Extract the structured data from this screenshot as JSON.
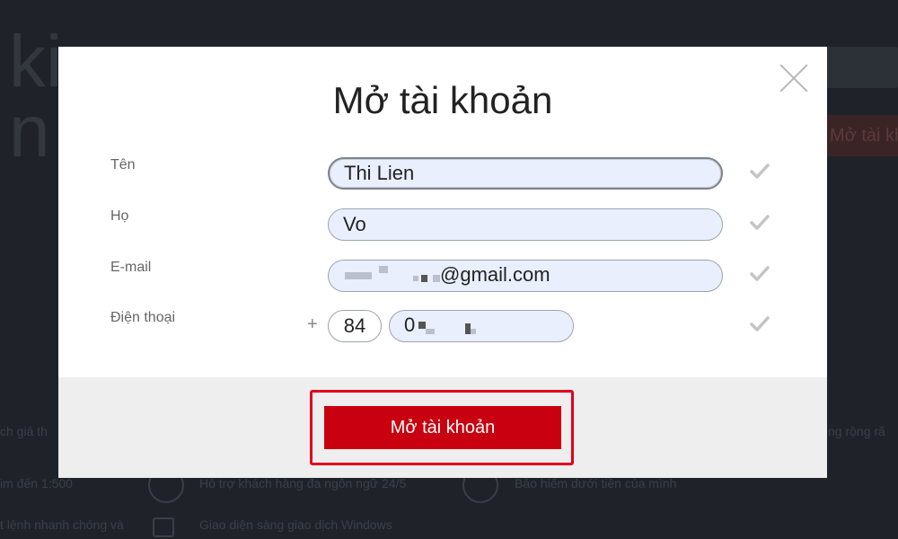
{
  "background": {
    "title_partial": "ki\nn b",
    "right_button_partial": "Mở tài kh",
    "features": [
      "ch giá th",
      "ng rộng rã",
      "im đến 1:500",
      "Hỗ trợ khách hàng đa ngôn ngữ 24/5",
      "Bảo hiểm dưới tiền của mình",
      "t lệnh nhanh chóng và",
      "Giao diện sàng giao dịch Windows"
    ]
  },
  "modal": {
    "title": "Mở tài khoản",
    "close_icon": "close-icon",
    "fields": {
      "first_name": {
        "label": "Tên",
        "value": "Thi Lien"
      },
      "last_name": {
        "label": "Họ",
        "value": "Vo"
      },
      "email": {
        "label": "E-mail",
        "value": "@gmail.com"
      },
      "phone": {
        "label": "Điện thoại",
        "prefix": "+",
        "country_code": "84",
        "number": "0"
      }
    },
    "check_icon": "check-icon",
    "submit_label": "Mở tài khoản"
  },
  "colors": {
    "accent": "#c8000f",
    "highlight": "#e0001b",
    "input_fill": "#e9effd",
    "overlay": "#1f2329"
  }
}
